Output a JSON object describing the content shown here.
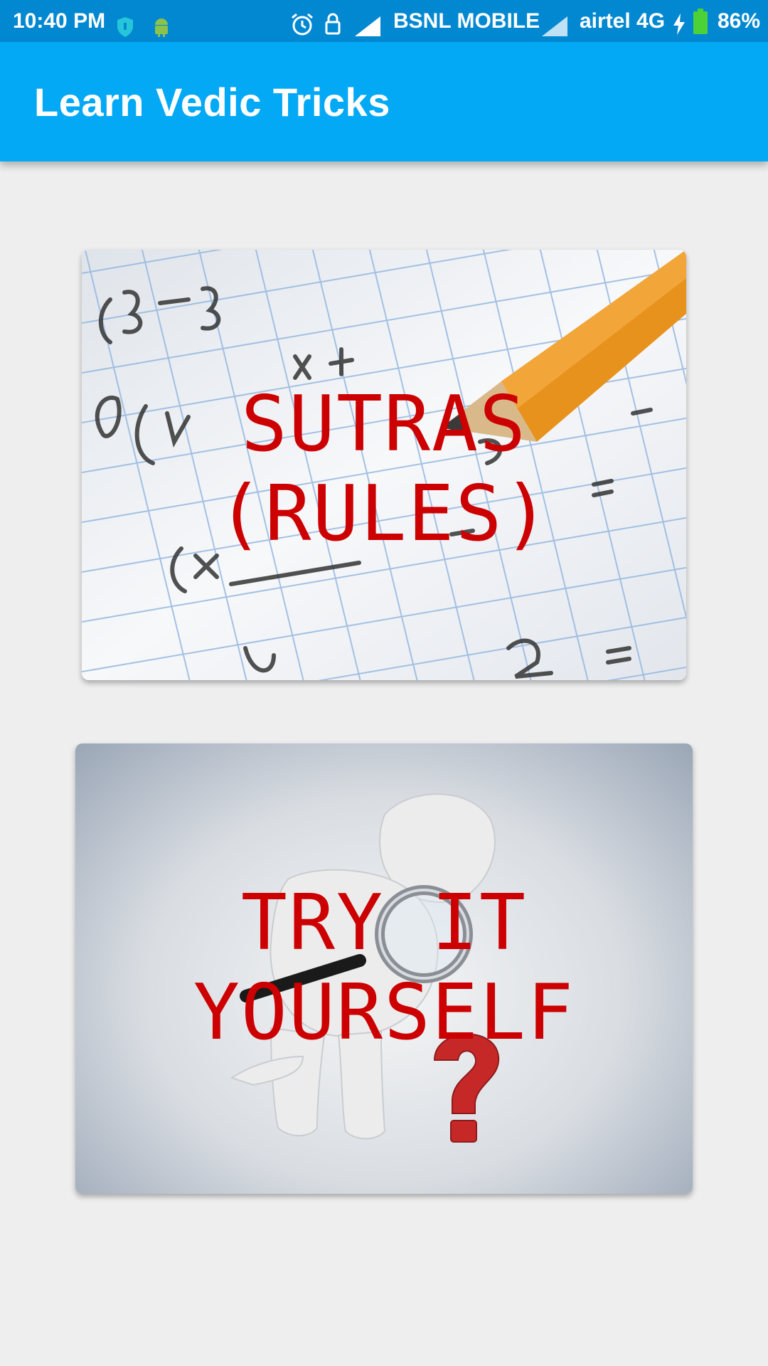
{
  "status_bar": {
    "time": "10:40 PM",
    "carrier_1": "BSNL MOBILE",
    "carrier_2": "airtel 4G",
    "battery": "86%",
    "icons": [
      "shield-icon",
      "android-icon",
      "alarm-icon",
      "lock-icon",
      "signal-icon",
      "signal-icon",
      "charging-icon",
      "battery-icon"
    ]
  },
  "app_bar": {
    "title": "Learn Vedic Tricks",
    "color": "#03a9f4"
  },
  "cards": [
    {
      "line1": "SUTRAS",
      "line2": "(RULES)",
      "image": "math-graph-paper-with-pencil"
    },
    {
      "line1": "TRY IT",
      "line2": "YOURSELF",
      "image": "figure-with-magnifying-glass-and-question-mark"
    }
  ],
  "colors": {
    "label_text": "#cc0000",
    "status_bar": "#0288d1",
    "background": "#eeeeee"
  }
}
